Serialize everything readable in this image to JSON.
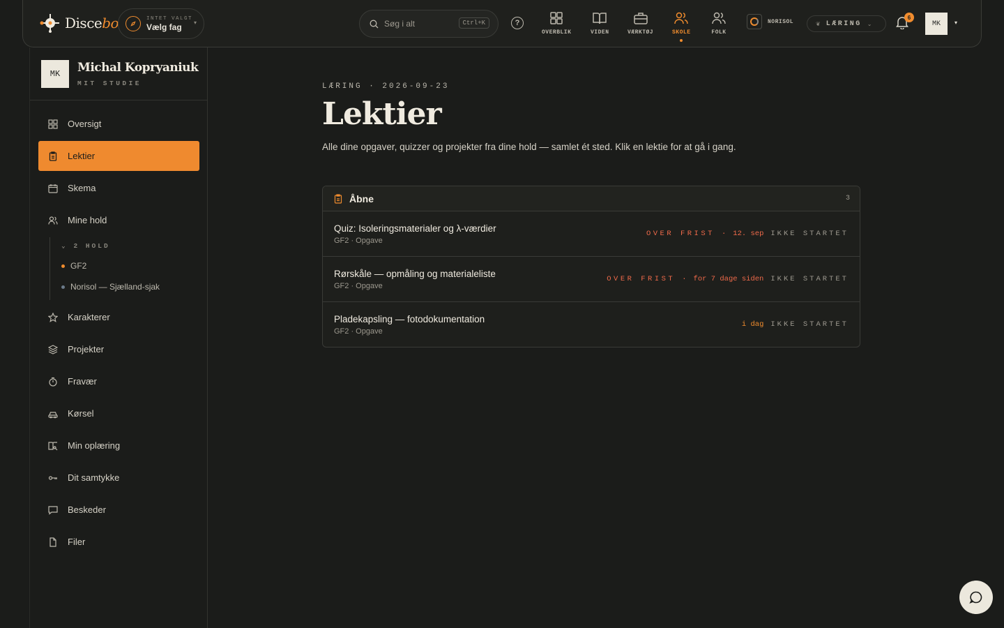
{
  "brand": {
    "name_main": "Disce",
    "name_accent": "bo"
  },
  "subject_picker": {
    "label": "INTET VALGT",
    "value": "Vælg fag"
  },
  "search": {
    "placeholder": "Søg i alt",
    "shortcut": "Ctrl+K"
  },
  "nav": [
    {
      "label": "OVERBLIK",
      "icon": "grid-icon",
      "active": false
    },
    {
      "label": "VIDEN",
      "icon": "book-icon",
      "active": false
    },
    {
      "label": "VÆRKTØJ",
      "icon": "briefcase-icon",
      "active": false
    },
    {
      "label": "SKOLE",
      "icon": "people-icon",
      "active": true
    },
    {
      "label": "FOLK",
      "icon": "person-icon",
      "active": false
    }
  ],
  "org": {
    "name": "NORISOL"
  },
  "mode": {
    "label": "LÆRING"
  },
  "notifications": {
    "count": "6"
  },
  "user": {
    "initials": "MK"
  },
  "profile": {
    "initials": "MK",
    "name": "Michal Kopryaniuk",
    "subtitle": "MIT STUDIE"
  },
  "sidebar": {
    "items": [
      {
        "label": "Oversigt",
        "icon": "dashboard-icon"
      },
      {
        "label": "Lektier",
        "icon": "clipboard-icon",
        "active": true
      },
      {
        "label": "Skema",
        "icon": "calendar-icon"
      },
      {
        "label": "Mine hold",
        "icon": "users-icon"
      },
      {
        "label": "Karakterer",
        "icon": "star-icon"
      },
      {
        "label": "Projekter",
        "icon": "layers-icon"
      },
      {
        "label": "Fravær",
        "icon": "timer-icon"
      },
      {
        "label": "Kørsel",
        "icon": "car-icon"
      },
      {
        "label": "Min oplæring",
        "icon": "book-open-icon"
      },
      {
        "label": "Dit samtykke",
        "icon": "key-icon"
      },
      {
        "label": "Beskeder",
        "icon": "message-icon"
      },
      {
        "label": "Filer",
        "icon": "file-icon"
      }
    ],
    "holds": {
      "header": "2 HOLD",
      "items": [
        {
          "label": "GF2",
          "color": "#f08c2e"
        },
        {
          "label": "Norisol — Sjælland-sjak",
          "color": "#6b7a8a"
        }
      ]
    }
  },
  "page": {
    "breadcrumb": "LÆRING · 2026-09-23",
    "title": "Lektier",
    "description": "Alle dine opgaver, quizzer og projekter fra dine hold — samlet ét sted. Klik en lektie for at gå i gang."
  },
  "open_panel": {
    "title": "Åbne",
    "count": "3",
    "rows": [
      {
        "title": "Quiz: Isoleringsmaterialer og λ-værdier",
        "meta": "GF2 · Opgave",
        "overdue": "OVER FRIST",
        "sep": "·",
        "due": "12. sep",
        "status": "IKKE STARTET"
      },
      {
        "title": "Rørskåle — opmåling og materialeliste",
        "meta": "GF2 · Opgave",
        "overdue": "OVER FRIST",
        "sep": "·",
        "due": "for 7 dage siden",
        "status": "IKKE STARTET"
      },
      {
        "title": "Pladekapsling — fotodokumentation",
        "meta": "GF2 · Opgave",
        "overdue": "",
        "sep": "",
        "due": "i dag",
        "status": "IKKE STARTET"
      }
    ]
  },
  "colors": {
    "accent": "#f08c2e",
    "overdue": "#ef6a4a",
    "background": "#1b1c1a"
  }
}
